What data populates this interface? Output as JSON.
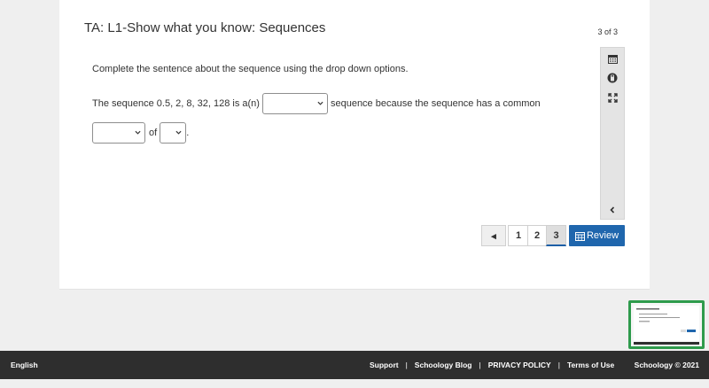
{
  "assessment": {
    "title": "TA: L1-Show what you know: Sequences",
    "question_counter": "3 of 3",
    "prompt": "Complete the sentence about the sequence using the drop down options.",
    "sentence_part1": "The sequence 0.5, 2, 8, 32, 128 is a(n)",
    "sentence_part2": "sequence because the sequence has a common",
    "sentence_part3": "of",
    "sentence_end": "."
  },
  "dropdowns": {
    "sequence_type_value": "",
    "common_term_value": "",
    "common_value": ""
  },
  "tools": [
    "calendar-icon",
    "calculator-icon",
    "expand-icon",
    "collapse-chevron-icon"
  ],
  "pagination": {
    "prev_label": "◂",
    "pages": [
      "1",
      "2",
      "3"
    ],
    "current_page": "3",
    "review_label": "Review"
  },
  "footer": {
    "language": "English",
    "links": [
      "Support",
      "Schoology Blog",
      "PRIVACY POLICY",
      "Terms of Use"
    ],
    "separator": "|",
    "copyright": "Schoology © 2021"
  },
  "colors": {
    "primary_button": "#1f66ad",
    "footer_bg": "#2e2e2e",
    "thumbnail_border": "#2e9b4c"
  }
}
